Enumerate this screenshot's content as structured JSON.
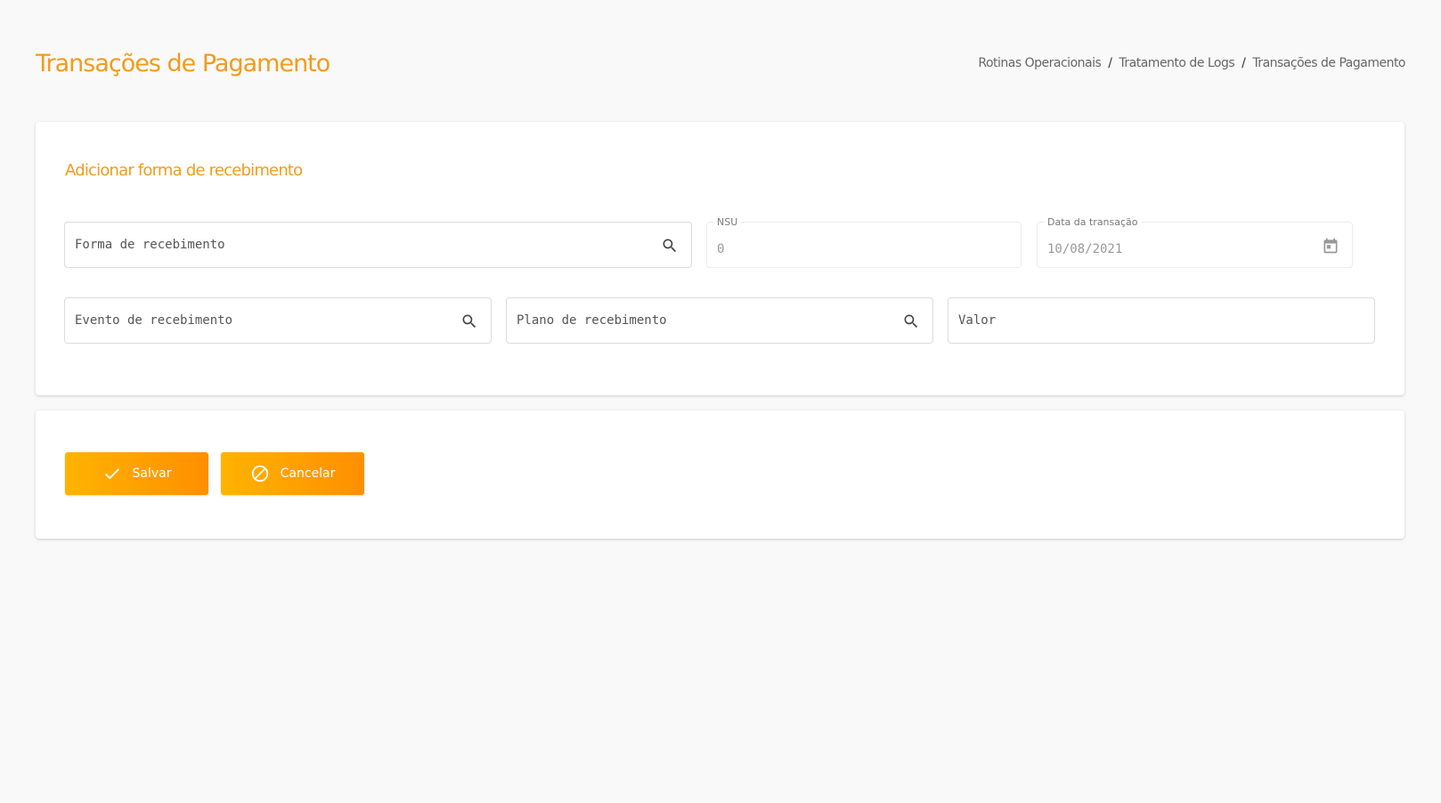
{
  "header": {
    "title": "Transações de Pagamento",
    "breadcrumb": [
      "Rotinas Operacionais",
      "Tratamento de Logs",
      "Transações de Pagamento"
    ],
    "separator": "/"
  },
  "form": {
    "section_title": "Adicionar forma de recebimento",
    "forma_recebimento": {
      "placeholder": "Forma de recebimento",
      "icon": "search-icon"
    },
    "nsu": {
      "label": "NSU",
      "value": "0"
    },
    "data_transacao": {
      "label": "Data da transação",
      "value": "10/08/2021",
      "icon": "calendar-icon"
    },
    "evento_recebimento": {
      "placeholder": "Evento de recebimento",
      "icon": "search-icon"
    },
    "plano_recebimento": {
      "placeholder": "Plano de recebimento",
      "icon": "search-icon"
    },
    "valor": {
      "placeholder": "Valor"
    }
  },
  "actions": {
    "save_label": "Salvar",
    "cancel_label": "Cancelar"
  },
  "colors": {
    "accent": "#f29b1d",
    "button_start": "#ffb300",
    "button_end": "#ff8f00"
  }
}
